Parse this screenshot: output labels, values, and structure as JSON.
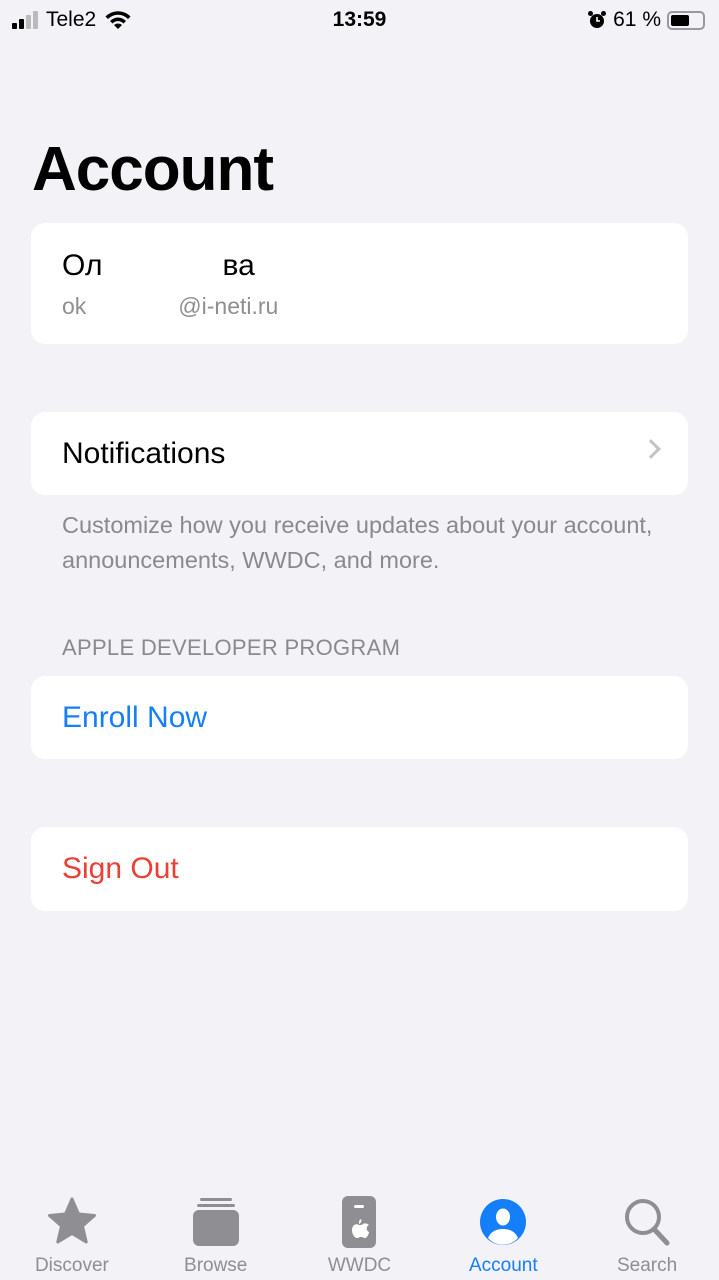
{
  "status_bar": {
    "carrier": "Tele2",
    "time": "13:59",
    "battery_percent": "61 %",
    "battery_level": 0.61,
    "signal_bars": 2,
    "icons": [
      "signal-icon",
      "wifi-icon",
      "alarm-icon",
      "battery-icon"
    ]
  },
  "page": {
    "title": "Account"
  },
  "profile": {
    "name_visible_start": "Ол",
    "name_visible_end": "ва",
    "email_visible_start": "ok",
    "email_visible_end": "@i-neti.ru"
  },
  "notifications": {
    "label": "Notifications",
    "footer": "Customize how you receive updates about your account, announcements, WWDC, and more."
  },
  "program": {
    "header": "APPLE DEVELOPER PROGRAM",
    "enroll_label": "Enroll Now"
  },
  "sign_out": {
    "label": "Sign Out"
  },
  "colors": {
    "accent": "#147efb",
    "destructive": "#eb4034",
    "background": "#f2f2f7",
    "inactive": "#8e8e93"
  },
  "tabs": [
    {
      "label": "Discover",
      "icon": "star-icon"
    },
    {
      "label": "Browse",
      "icon": "stack-icon"
    },
    {
      "label": "WWDC",
      "icon": "wwdc-icon"
    },
    {
      "label": "Account",
      "icon": "person-circle-icon",
      "active": true
    },
    {
      "label": "Search",
      "icon": "search-icon"
    }
  ]
}
